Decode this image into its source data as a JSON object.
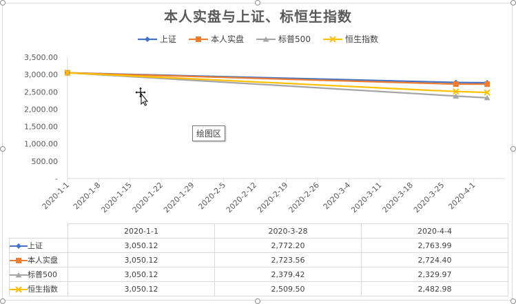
{
  "chart_data": {
    "type": "line",
    "title": "本人实盘与上证、标恒生指数",
    "xlabel": "",
    "ylabel": "",
    "x_axis_type": "date",
    "xlim": [
      "2020-1-1",
      "2020-4-8"
    ],
    "x_tick_labels": [
      "2020-1-1",
      "2020-1-8",
      "2020-1-15",
      "2020-1-22",
      "2020-1-29",
      "2020-2-5",
      "2020-2-12",
      "2020-2-19",
      "2020-2-26",
      "2020-3-4",
      "2020-3-11",
      "2020-3-18",
      "2020-3-25",
      "2020-4-1"
    ],
    "ylim": [
      0,
      3500
    ],
    "y_tick_values": [
      0,
      500,
      1000,
      1500,
      2000,
      2500,
      3000,
      3500
    ],
    "y_tick_labels": [
      "-",
      "500.00",
      "1,000.00",
      "1,500.00",
      "2,000.00",
      "2,500.00",
      "3,000.00",
      "3,500.00"
    ],
    "x": [
      "2020-1-1",
      "2020-3-28",
      "2020-4-4"
    ],
    "series": [
      {
        "name": "上证",
        "color": "#4472c4",
        "marker": "diamond",
        "values": [
          3050.12,
          2772.2,
          2763.99
        ],
        "labels": [
          "3,050.12",
          "2,772.20",
          "2,763.99"
        ]
      },
      {
        "name": "本人实盘",
        "color": "#ed7d31",
        "marker": "square",
        "values": [
          3050.12,
          2723.56,
          2724.4
        ],
        "labels": [
          "3,050.12",
          "2,723.56",
          "2,724.40"
        ]
      },
      {
        "name": "标普500",
        "color": "#a5a5a5",
        "marker": "triangle",
        "values": [
          3050.12,
          2379.42,
          2329.97
        ],
        "labels": [
          "3,050.12",
          "2,379.42",
          "2,329.97"
        ]
      },
      {
        "name": "恒生指数",
        "color": "#ffc000",
        "marker": "x",
        "values": [
          3050.12,
          2509.5,
          2482.98
        ],
        "labels": [
          "3,050.12",
          "2,509.50",
          "2,482.98"
        ]
      }
    ],
    "grid": false,
    "legend": "top"
  },
  "tooltip_text": "绘图区"
}
